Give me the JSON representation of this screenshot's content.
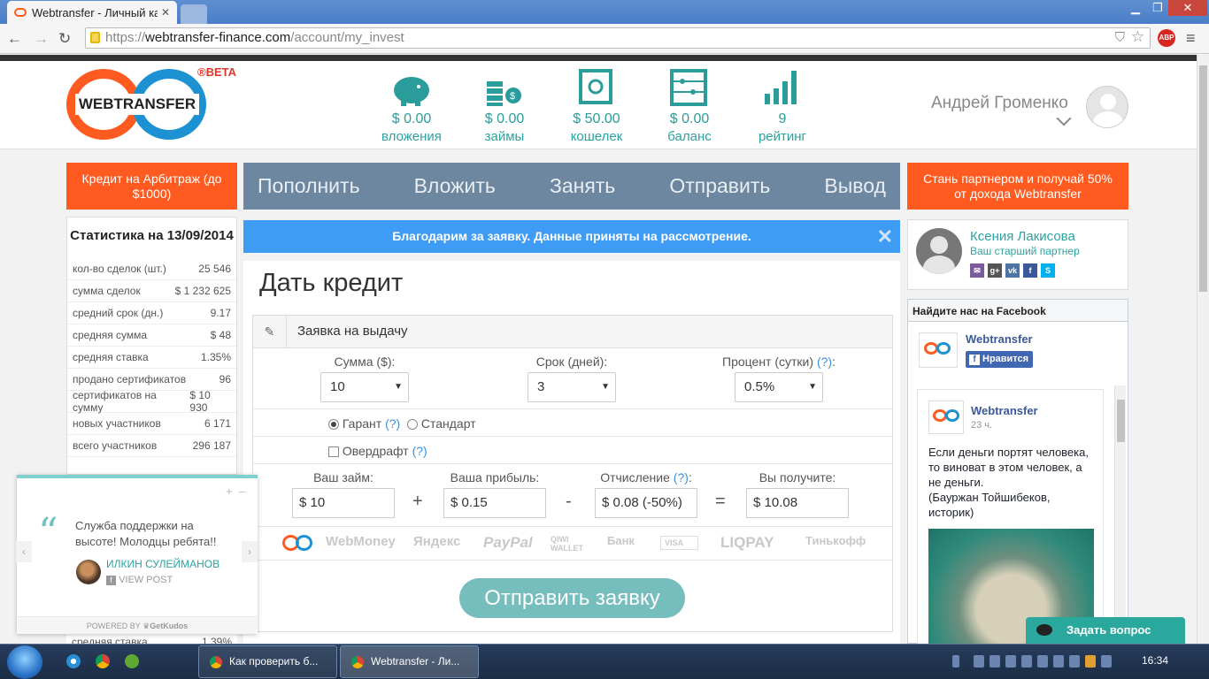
{
  "browser": {
    "active_tab_title": "Webtransfer - Личный ка",
    "url_scheme": "https://",
    "url_host": "webtransfer-finance.com",
    "url_path": "/account/my_invest",
    "abp_label": "ABP"
  },
  "header": {
    "logo_text": "WEBTRANSFER",
    "beta_label": "®BETA",
    "stats": [
      {
        "value": "$ 0.00",
        "label": "вложения",
        "icon": "piggy-bank-icon"
      },
      {
        "value": "$ 0.00",
        "label": "займы",
        "icon": "coins-icon"
      },
      {
        "value": "$ 50.00",
        "label": "кошелек",
        "icon": "safe-icon"
      },
      {
        "value": "$ 0.00",
        "label": "баланс",
        "icon": "abacus-icon"
      },
      {
        "value": "9",
        "label": "рейтинг",
        "icon": "growth-chart-icon"
      }
    ],
    "user_name": "Андрей Громенко"
  },
  "promo_left": "Кредит на Арбитраж (до $1000)",
  "promo_right": "Стань партнером и получай 50% от дохода Webtransfer",
  "nav": [
    "Пополнить",
    "Вложить",
    "Занять",
    "Отправить",
    "Вывод"
  ],
  "stats_panel": {
    "title": "Статистика на 13/09/2014",
    "rows": [
      {
        "label": "кол-во сделок (шт.)",
        "value": "25 546"
      },
      {
        "label": "сумма сделок",
        "value": "$ 1 232 625"
      },
      {
        "label": "средний срок (дн.)",
        "value": "9.17"
      },
      {
        "label": "средняя сумма",
        "value": "$ 48"
      },
      {
        "label": "средняя ставка",
        "value": "1.35%"
      },
      {
        "label": "продано сертификатов",
        "value": "96"
      },
      {
        "label": "сертификатов на сумму",
        "value": "$ 10 930"
      },
      {
        "label": "новых участников",
        "value": "6 171"
      },
      {
        "label": "всего участников",
        "value": "296 187"
      }
    ],
    "hidden_row_label": "средняя ставка",
    "hidden_row_value": "1.39%"
  },
  "alert": {
    "text": "Благодарим за заявку. Данные приняты на рассмотрение.",
    "close": "✕"
  },
  "page_title": "Дать кредит",
  "form": {
    "panel_title": "Заявка на выдачу",
    "sum_label": "Сумма ($):",
    "sum_value": "10",
    "term_label": "Срок (дней):",
    "term_value": "3",
    "percent_label": "Процент (сутки)",
    "percent_value": "0.5%",
    "help": "(?)",
    "guarantee_label": "Гарант",
    "standard_label": "Стандарт",
    "overdraft_label": "Овердрафт",
    "loan_label": "Ваш займ:",
    "loan_value": "$ 10",
    "profit_label": "Ваша прибыль:",
    "profit_value": "$ 0.15",
    "fee_label": "Отчисление",
    "fee_value": "$ 0.08 (-50%)",
    "receive_label": "Вы получите:",
    "receive_value": "$ 10.08",
    "plus": "+",
    "minus": "-",
    "equals": "=",
    "payments": [
      "WebMoney",
      "Яндекс",
      "PayPal",
      "QIWI WALLET",
      "Банк",
      "VISA",
      "LIQPAY",
      "Тинькофф"
    ],
    "submit_label": "Отправить заявку"
  },
  "partner": {
    "name": "Ксения Лакисова",
    "role": "Ваш старший партнер"
  },
  "facebook": {
    "header": "Найдите нас на Facebook",
    "page_name": "Webtransfer",
    "like_label": "Нравится",
    "post_author": "Webtransfer",
    "post_time": "23 ч.",
    "post_text": "Если деньги портят человека, то виноват в этом человек, а не деньги.",
    "post_sign": "(Бауржан Тойшибеков, историк)"
  },
  "kudos": {
    "quote": "Служба поддержки на высоте! Молодцы ребята!!",
    "author": "ИЛКИН СУЛЕЙМАНОВ",
    "view_post": "VIEW POST",
    "powered_by": "POWERED BY",
    "brand": "GetKudos"
  },
  "ask_button": "Задать вопрос",
  "taskbar": {
    "task1": "Как проверить б...",
    "task2": "Webtransfer - Ли...",
    "time": "16:34"
  }
}
